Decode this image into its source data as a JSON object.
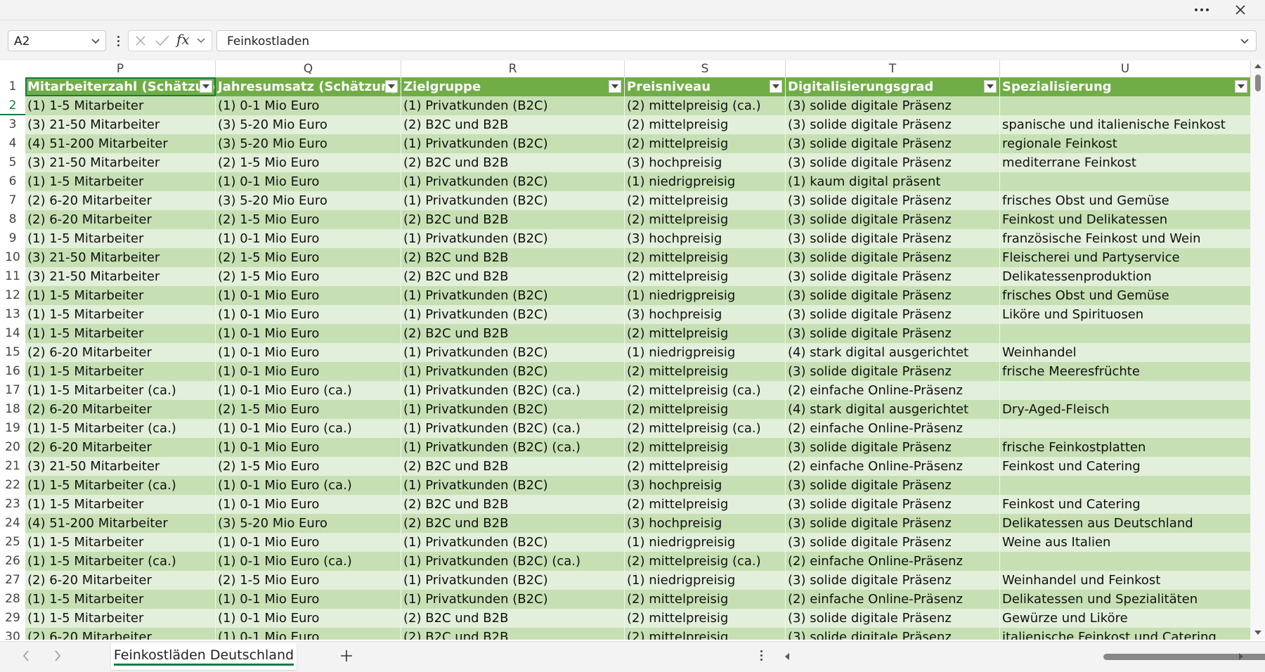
{
  "window": {
    "more_icon": "more-icon",
    "close_icon": "close-icon"
  },
  "formula_bar": {
    "name_box": "A2",
    "fx_label": "fx",
    "formula": "Feinkostladen"
  },
  "columns": [
    "P",
    "Q",
    "R",
    "S",
    "T",
    "U"
  ],
  "headers": [
    "Mitarbeiterzahl (Schätzung)",
    "Jahresumsatz (Schätzung)",
    "Zielgruppe",
    "Preisniveau",
    "Digitalisierungsgrad",
    "Spezialisierung"
  ],
  "rows": [
    {
      "n": "2",
      "c": [
        "(1) 1-5 Mitarbeiter",
        "(1) 0-1 Mio Euro",
        "(1) Privatkunden (B2C)",
        "(2) mittelpreisig (ca.)",
        "(3) solide digitale Präsenz",
        ""
      ]
    },
    {
      "n": "3",
      "c": [
        "(3) 21-50 Mitarbeiter",
        "(3) 5-20 Mio Euro",
        "(2) B2C und B2B",
        "(2) mittelpreisig",
        "(3) solide digitale Präsenz",
        "spanische und italienische Feinkost"
      ]
    },
    {
      "n": "4",
      "c": [
        "(4) 51-200 Mitarbeiter",
        "(3) 5-20 Mio Euro",
        "(1) Privatkunden (B2C)",
        "(2) mittelpreisig",
        "(3) solide digitale Präsenz",
        "regionale Feinkost"
      ]
    },
    {
      "n": "5",
      "c": [
        "(3) 21-50 Mitarbeiter",
        "(2) 1-5 Mio Euro",
        "(2) B2C und B2B",
        "(3) hochpreisig",
        "(3) solide digitale Präsenz",
        "mediterrane Feinkost"
      ]
    },
    {
      "n": "6",
      "c": [
        "(1) 1-5 Mitarbeiter",
        "(1) 0-1 Mio Euro",
        "(1) Privatkunden (B2C)",
        "(1) niedrigpreisig",
        "(1) kaum digital präsent",
        ""
      ]
    },
    {
      "n": "7",
      "c": [
        "(2) 6-20 Mitarbeiter",
        "(3) 5-20 Mio Euro",
        "(1) Privatkunden (B2C)",
        "(2) mittelpreisig",
        "(3) solide digitale Präsenz",
        "frisches Obst und Gemüse"
      ]
    },
    {
      "n": "8",
      "c": [
        "(2) 6-20 Mitarbeiter",
        "(2) 1-5 Mio Euro",
        "(2) B2C und B2B",
        "(2) mittelpreisig",
        "(3) solide digitale Präsenz",
        "Feinkost und Delikatessen"
      ]
    },
    {
      "n": "9",
      "c": [
        "(1) 1-5 Mitarbeiter",
        "(1) 0-1 Mio Euro",
        "(1) Privatkunden (B2C)",
        "(3) hochpreisig",
        "(3) solide digitale Präsenz",
        "französische Feinkost und Wein"
      ]
    },
    {
      "n": "10",
      "c": [
        "(3) 21-50 Mitarbeiter",
        "(2) 1-5 Mio Euro",
        "(2) B2C und B2B",
        "(2) mittelpreisig",
        "(3) solide digitale Präsenz",
        "Fleischerei und Partyservice"
      ]
    },
    {
      "n": "11",
      "c": [
        "(3) 21-50 Mitarbeiter",
        "(2) 1-5 Mio Euro",
        "(2) B2C und B2B",
        "(2) mittelpreisig",
        "(3) solide digitale Präsenz",
        "Delikatessenproduktion"
      ]
    },
    {
      "n": "12",
      "c": [
        "(1) 1-5 Mitarbeiter",
        "(1) 0-1 Mio Euro",
        "(1) Privatkunden (B2C)",
        "(1) niedrigpreisig",
        "(3) solide digitale Präsenz",
        "frisches Obst und Gemüse"
      ]
    },
    {
      "n": "13",
      "c": [
        "(1) 1-5 Mitarbeiter",
        "(1) 0-1 Mio Euro",
        "(1) Privatkunden (B2C)",
        "(3) hochpreisig",
        "(3) solide digitale Präsenz",
        "Liköre und Spirituosen"
      ]
    },
    {
      "n": "14",
      "c": [
        "(1) 1-5 Mitarbeiter",
        "(1) 0-1 Mio Euro",
        "(2) B2C und B2B",
        "(2) mittelpreisig",
        "(3) solide digitale Präsenz",
        ""
      ]
    },
    {
      "n": "15",
      "c": [
        "(2) 6-20 Mitarbeiter",
        "(1) 0-1 Mio Euro",
        "(1) Privatkunden (B2C)",
        "(1) niedrigpreisig",
        "(4) stark digital ausgerichtet",
        "Weinhandel"
      ]
    },
    {
      "n": "16",
      "c": [
        "(1) 1-5 Mitarbeiter",
        "(1) 0-1 Mio Euro",
        "(1) Privatkunden (B2C)",
        "(2) mittelpreisig",
        "(3) solide digitale Präsenz",
        "frische Meeresfrüchte"
      ]
    },
    {
      "n": "17",
      "c": [
        "(1) 1-5 Mitarbeiter (ca.)",
        "(1) 0-1 Mio Euro (ca.)",
        "(1) Privatkunden (B2C) (ca.)",
        "(2) mittelpreisig (ca.)",
        "(2) einfache Online-Präsenz",
        ""
      ]
    },
    {
      "n": "18",
      "c": [
        "(2) 6-20 Mitarbeiter",
        "(2) 1-5 Mio Euro",
        "(1) Privatkunden (B2C)",
        "(2) mittelpreisig",
        "(4) stark digital ausgerichtet",
        "Dry-Aged-Fleisch"
      ]
    },
    {
      "n": "19",
      "c": [
        "(1) 1-5 Mitarbeiter (ca.)",
        "(1) 0-1 Mio Euro (ca.)",
        "(1) Privatkunden (B2C) (ca.)",
        "(2) mittelpreisig (ca.)",
        "(2) einfache Online-Präsenz",
        ""
      ]
    },
    {
      "n": "20",
      "c": [
        "(2) 6-20 Mitarbeiter",
        "(1) 0-1 Mio Euro",
        "(1) Privatkunden (B2C) (ca.)",
        "(2) mittelpreisig",
        "(3) solide digitale Präsenz",
        "frische Feinkostplatten"
      ]
    },
    {
      "n": "21",
      "c": [
        "(3) 21-50 Mitarbeiter",
        "(2) 1-5 Mio Euro",
        "(2) B2C und B2B",
        "(2) mittelpreisig",
        "(2) einfache Online-Präsenz",
        "Feinkost und Catering"
      ]
    },
    {
      "n": "22",
      "c": [
        "(1) 1-5 Mitarbeiter (ca.)",
        "(1) 0-1 Mio Euro (ca.)",
        "(1) Privatkunden (B2C)",
        "(3) hochpreisig",
        "(3) solide digitale Präsenz",
        ""
      ]
    },
    {
      "n": "23",
      "c": [
        "(1) 1-5 Mitarbeiter",
        "(1) 0-1 Mio Euro",
        "(2) B2C und B2B",
        "(2) mittelpreisig",
        "(3) solide digitale Präsenz",
        "Feinkost und Catering"
      ]
    },
    {
      "n": "24",
      "c": [
        "(4) 51-200 Mitarbeiter",
        "(3) 5-20 Mio Euro",
        "(2) B2C und B2B",
        "(3) hochpreisig",
        "(3) solide digitale Präsenz",
        "Delikatessen aus Deutschland"
      ]
    },
    {
      "n": "25",
      "c": [
        "(1) 1-5 Mitarbeiter",
        "(1) 0-1 Mio Euro",
        "(1) Privatkunden (B2C)",
        "(1) niedrigpreisig",
        "(3) solide digitale Präsenz",
        "Weine aus Italien"
      ]
    },
    {
      "n": "26",
      "c": [
        "(1) 1-5 Mitarbeiter (ca.)",
        "(1) 0-1 Mio Euro (ca.)",
        "(1) Privatkunden (B2C) (ca.)",
        "(2) mittelpreisig (ca.)",
        "(2) einfache Online-Präsenz",
        ""
      ]
    },
    {
      "n": "27",
      "c": [
        "(2) 6-20 Mitarbeiter",
        "(2) 1-5 Mio Euro",
        "(1) Privatkunden (B2C)",
        "(1) niedrigpreisig",
        "(3) solide digitale Präsenz",
        "Weinhandel und Feinkost"
      ]
    },
    {
      "n": "28",
      "c": [
        "(1) 1-5 Mitarbeiter",
        "(1) 0-1 Mio Euro",
        "(1) Privatkunden (B2C)",
        "(2) mittelpreisig",
        "(2) einfache Online-Präsenz",
        "Delikatessen und Spezialitäten"
      ]
    },
    {
      "n": "29",
      "c": [
        "(1) 1-5 Mitarbeiter",
        "(1) 0-1 Mio Euro",
        "(2) B2C und B2B",
        "(2) mittelpreisig",
        "(3) solide digitale Präsenz",
        "Gewürze und Liköre"
      ]
    },
    {
      "n": "30",
      "c": [
        "(2) 6-20 Mitarbeiter",
        "(1) 0-1 Mio Euro",
        "(2) B2C und B2B",
        "(2) mittelpreisig",
        "(3) solide digitale Präsenz",
        "italienische Feinkost und Catering"
      ]
    }
  ],
  "sheet_tabs": [
    "Feinkostläden Deutschland"
  ],
  "colors": {
    "header": "#70ad47",
    "band_dark": "#c6e0b4",
    "band_light": "#e2efda",
    "accent": "#107c41"
  }
}
